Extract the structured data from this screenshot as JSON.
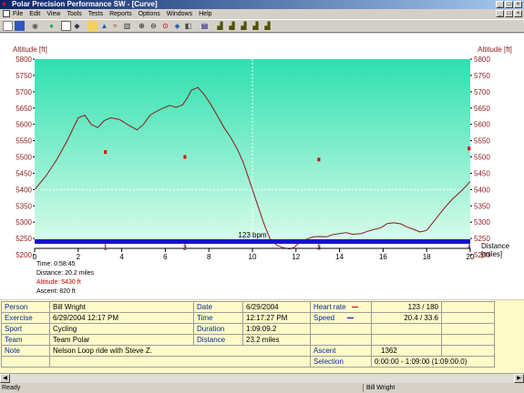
{
  "window": {
    "title": "Polar Precision Performance SW - [Curve]"
  },
  "menu": [
    "File",
    "Edit",
    "View",
    "Tools",
    "Tests",
    "Reports",
    "Options",
    "Windows",
    "Help"
  ],
  "toolbar_icons": [
    "new-icon",
    "save-icon",
    "find-icon",
    "globe-icon",
    "calendar-icon",
    "diary-icon",
    "open-folder-icon",
    "chart-icon",
    "trend-icon",
    "bars-icon",
    "zoom-in-icon",
    "zoom-out-icon",
    "zoom-fit-icon",
    "marker-icon",
    "lap-icon",
    "report-icon",
    "graph-a-icon",
    "graph-b-icon",
    "graph-c-icon",
    "graph-d-icon"
  ],
  "chart_data": {
    "type": "line",
    "ylabel_left": "Altitude [ft]",
    "ylabel_right": "Altitude [ft]",
    "xlabel": "Distance\n[miles]",
    "ylim": [
      5175,
      5800
    ],
    "xlim": [
      0,
      20
    ],
    "yticks": [
      5200,
      5250,
      5300,
      5350,
      5400,
      5450,
      5500,
      5550,
      5600,
      5650,
      5700,
      5750,
      5800
    ],
    "xticks": [
      0,
      2,
      4,
      6,
      8,
      10,
      12,
      14,
      16,
      18,
      20
    ],
    "series": [
      {
        "color": "#8b1a1a",
        "x": [
          0,
          0.5,
          1,
          1.5,
          2,
          2.3,
          2.6,
          2.9,
          3.2,
          3.5,
          3.9,
          4.3,
          4.7,
          5.0,
          5.3,
          5.6,
          5.9,
          6.2,
          6.5,
          6.8,
          7.0,
          7.2,
          7.5,
          7.8,
          8.1,
          8.4,
          8.7,
          9.0,
          9.3,
          9.6,
          9.9,
          10.2,
          10.5,
          10.8,
          11.1,
          11.4,
          11.7,
          11.9,
          12.2,
          12.5,
          12.8,
          13.1,
          13.4,
          13.7,
          14.0,
          14.3,
          14.6,
          15.0,
          15.3,
          15.6,
          15.9,
          16.2,
          16.5,
          16.8,
          17.1,
          17.4,
          17.7,
          18.0,
          18.3,
          18.6,
          18.9,
          19.2,
          19.5,
          19.8,
          20
        ],
        "y": [
          5400,
          5440,
          5490,
          5550,
          5620,
          5628,
          5600,
          5590,
          5612,
          5620,
          5615,
          5598,
          5583,
          5600,
          5628,
          5640,
          5650,
          5658,
          5652,
          5660,
          5680,
          5705,
          5713,
          5690,
          5660,
          5625,
          5590,
          5560,
          5525,
          5480,
          5420,
          5360,
          5300,
          5250,
          5230,
          5222,
          5218,
          5222,
          5240,
          5248,
          5255,
          5256,
          5255,
          5262,
          5265,
          5268,
          5263,
          5265,
          5272,
          5278,
          5283,
          5296,
          5298,
          5295,
          5285,
          5278,
          5270,
          5275,
          5300,
          5325,
          5350,
          5372,
          5390,
          5410,
          5425
        ]
      }
    ],
    "markers": [
      {
        "label": "1",
        "x": 3.25
      },
      {
        "label": "2",
        "x": 6.9
      },
      {
        "label": "3",
        "x": 13.05
      },
      {
        "label": "4",
        "x": 19.95
      }
    ],
    "red_points": [
      {
        "x": 3.25,
        "y": 5515
      },
      {
        "x": 6.9,
        "y": 5500
      },
      {
        "x": 13.05,
        "y": 5492
      },
      {
        "x": 19.95,
        "y": 5526
      }
    ],
    "hr_band_label": "123 bpm",
    "summary": {
      "time": "Time: 0:58:45",
      "distance": "Distance: 20.2 miles",
      "altitude": "Altitude: 5430 ft",
      "ascent": "Ascent: 820 ft"
    },
    "colors": {
      "fill_top": "#2ee0b0",
      "fill_bottom": "#d6fbe9",
      "axis_text": "#8b1a1a",
      "hr_band": "#1414c8",
      "curve": "#8b1a1a"
    }
  },
  "info_table": {
    "rows": [
      [
        "Person",
        "Bill Wright",
        "Date",
        "6/29/2004",
        "Heart rate",
        "123 / 180"
      ],
      [
        "Exercise",
        "6/29/2004 12:17 PM",
        "Time",
        "12:17:27 PM",
        "Speed",
        "20.4 / 33.6"
      ],
      [
        "Sport",
        "Cycling",
        "Duration",
        "1:09:09.2",
        "",
        ""
      ],
      [
        "Team",
        "Team Polar",
        "Distance",
        "23.2 miles",
        "",
        ""
      ],
      [
        "Note",
        "Nelson Loop ride with Steve Z.",
        "",
        "",
        "Ascent",
        "1362"
      ],
      [
        "",
        "",
        "",
        "",
        "Selection",
        "0:00:00 - 1:09:00 (1:09:00.0)"
      ]
    ],
    "hr_line_color": "#d00000",
    "speed_line_color": "#0000c0"
  },
  "status": {
    "left": "Ready",
    "user": "Bill Wright"
  }
}
